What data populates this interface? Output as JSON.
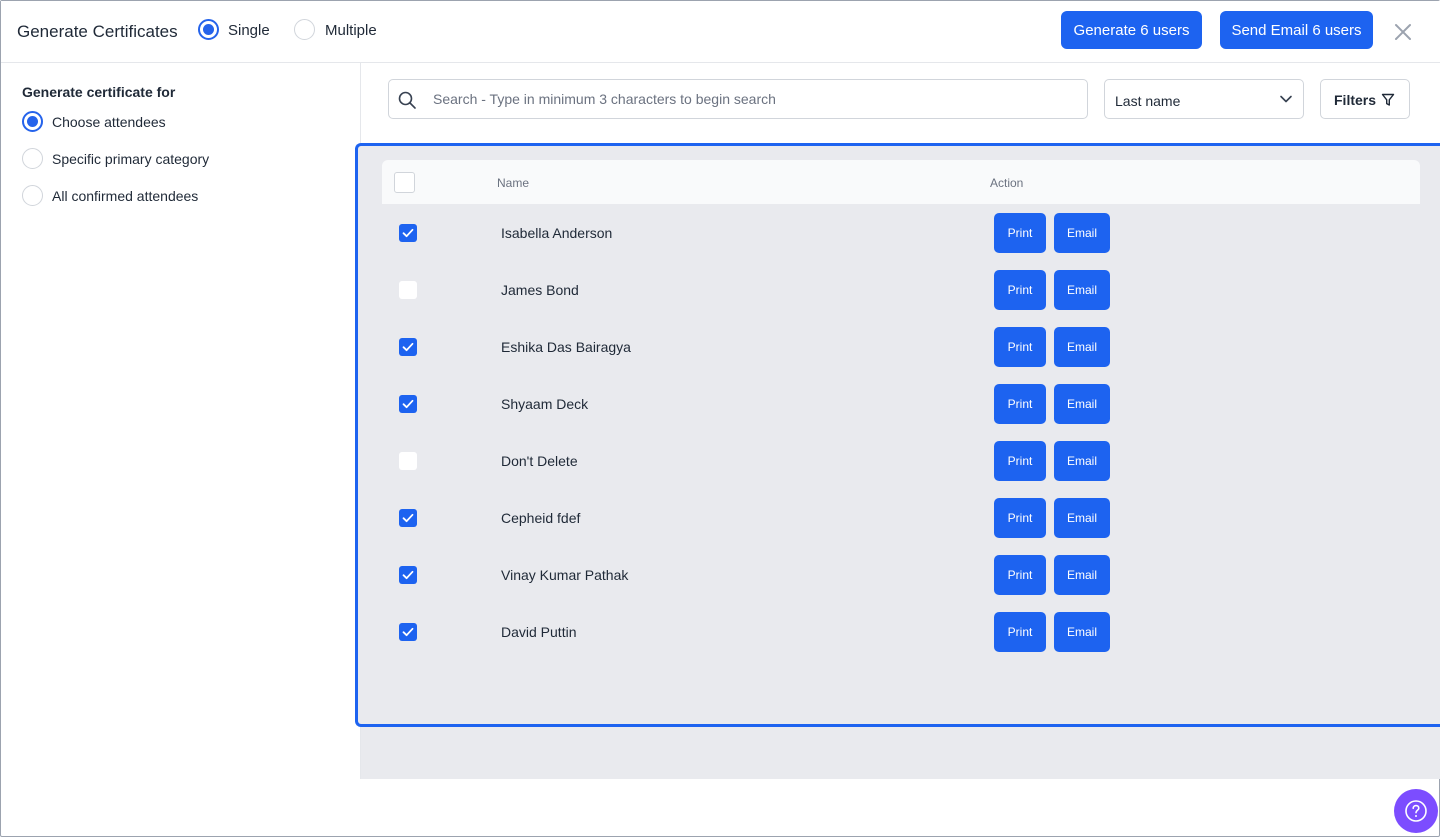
{
  "header": {
    "title": "Generate Certificates",
    "mode_options": [
      {
        "label": "Single",
        "selected": true
      },
      {
        "label": "Multiple",
        "selected": false
      }
    ],
    "generate_label": "Generate 6 users",
    "send_email_label": "Send Email 6 users"
  },
  "sidebar": {
    "heading": "Generate certificate for",
    "options": [
      {
        "label": "Choose attendees",
        "selected": true
      },
      {
        "label": "Specific primary category",
        "selected": false
      },
      {
        "label": "All confirmed attendees",
        "selected": false
      }
    ]
  },
  "toolbar": {
    "search_placeholder": "Search - Type in minimum 3 characters to begin search",
    "search_value": "",
    "sort_value": "Last name",
    "filters_label": "Filters"
  },
  "table": {
    "columns": [
      "Name",
      "Action"
    ],
    "print_label": "Print",
    "email_label": "Email",
    "rows": [
      {
        "name": "Isabella Anderson",
        "checked": true
      },
      {
        "name": "James Bond",
        "checked": false
      },
      {
        "name": "Eshika Das Bairagya",
        "checked": true
      },
      {
        "name": "Shyaam Deck",
        "checked": true
      },
      {
        "name": "Don't Delete",
        "checked": false
      },
      {
        "name": "Cepheid fdef",
        "checked": true
      },
      {
        "name": "Vinay Kumar Pathak",
        "checked": true
      },
      {
        "name": "David Puttin",
        "checked": true
      }
    ]
  },
  "icons": {
    "close": "close-icon",
    "search": "search-icon",
    "chevron": "chevron-down-icon",
    "filter": "filter-icon",
    "help": "help-icon",
    "check": "check-icon"
  },
  "colors": {
    "primary": "#1d63f0",
    "help": "#7c4dff",
    "panel_bg": "#e9eaee"
  }
}
